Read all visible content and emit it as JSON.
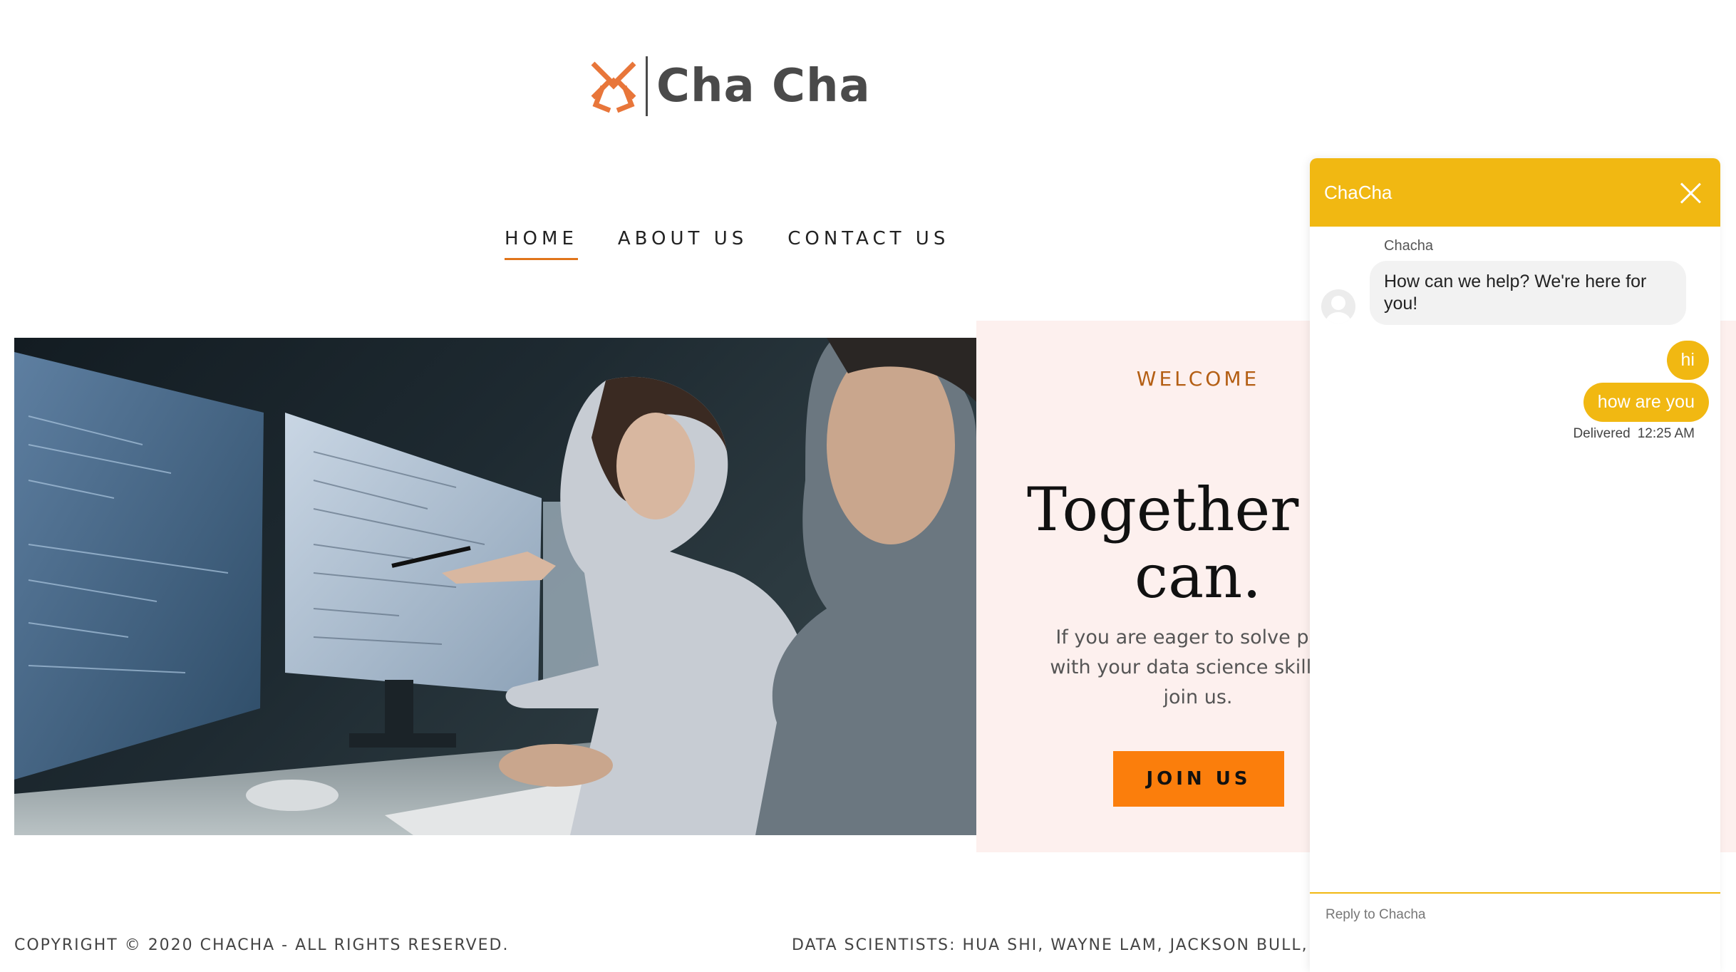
{
  "brand": {
    "name": "Cha Cha",
    "accent_color": "#e8763a"
  },
  "nav": {
    "items": [
      {
        "label": "HOME",
        "active": true
      },
      {
        "label": "ABOUT US",
        "active": false
      },
      {
        "label": "CONTACT US",
        "active": false
      }
    ],
    "active_underline_color": "#e0751b"
  },
  "hero": {
    "image_icon": "people-at-monitors-photo",
    "eyebrow": "WELCOME",
    "headline_line1": "Together w",
    "headline_line2": "can.",
    "body_line1": "If you are eager to solve prob",
    "body_line2": "with your data science skills, p",
    "body_line3": "join us.",
    "cta_label": "JOIN US",
    "cta_color": "#fb7e0c",
    "panel_color": "#fdf0ee"
  },
  "footer": {
    "copyright": "COPYRIGHT © 2020 CHACHA - ALL RIGHTS RESERVED.",
    "credits": "DATA SCIENTISTS: HUA SHI, WAYNE LAM, JACKSON BULL, BR"
  },
  "chat": {
    "title": "ChaCha",
    "header_color": "#f1b812",
    "close_icon": "close-icon",
    "agent_name": "Chacha",
    "agent_message": "How can we help? We're here for you!",
    "user_messages": [
      "hi",
      "how are you"
    ],
    "delivery_status": "Delivered",
    "delivery_time": "12:25 AM",
    "reply_placeholder": "Reply to Chacha"
  }
}
